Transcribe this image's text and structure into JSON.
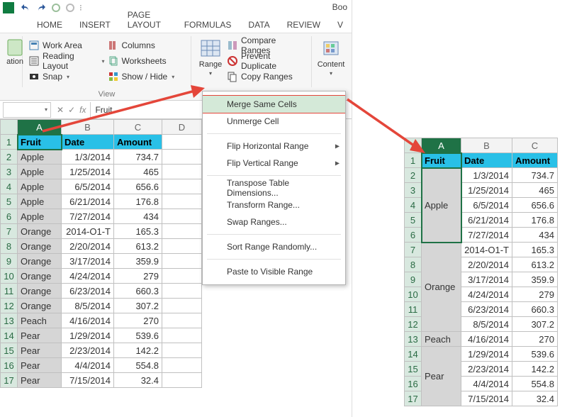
{
  "window": {
    "docName": "Boo"
  },
  "qat": {},
  "tabs": {
    "home": "HOME",
    "insert": "INSERT",
    "page": "PAGE LAYOUT",
    "formulas": "FORMULAS",
    "data": "DATA",
    "review": "REVIEW",
    "v": "V"
  },
  "ribbon": {
    "navigation": {
      "label": "ation"
    },
    "view": {
      "workArea": "Work Area",
      "readingLayout": "Reading Layout",
      "snap": "Snap",
      "columns": "Columns",
      "worksheets": "Worksheets",
      "showHide": "Show / Hide",
      "groupLabel": "View"
    },
    "range": {
      "label": "Range",
      "compare": "Compare Ranges",
      "prevent": "Prevent Duplicate",
      "copy": "Copy Ranges"
    },
    "content": {
      "label": "Content"
    }
  },
  "nameBox": "",
  "formula": "Fruit",
  "menu": {
    "merge": "Merge Same Cells",
    "unmerge": "Unmerge Cell",
    "flipH": "Flip Horizontal Range",
    "flipV": "Flip Vertical Range",
    "transpose": "Transpose Table Dimensions...",
    "transform": "Transform Range...",
    "swap": "Swap Ranges...",
    "sortR": "Sort Range Randomly...",
    "pasteVis": "Paste to Visible Range"
  },
  "table": {
    "headers": {
      "a": "Fruit",
      "b": "Date",
      "c": "Amount"
    },
    "rows": [
      {
        "a": "Apple",
        "b": "1/3/2014",
        "c": "734.7"
      },
      {
        "a": "Apple",
        "b": "1/25/2014",
        "c": "465"
      },
      {
        "a": "Apple",
        "b": "6/5/2014",
        "c": "656.6"
      },
      {
        "a": "Apple",
        "b": "6/21/2014",
        "c": "176.8"
      },
      {
        "a": "Apple",
        "b": "7/27/2014",
        "c": "434"
      },
      {
        "a": "Orange",
        "b": "2014-O1-T",
        "c": "165.3"
      },
      {
        "a": "Orange",
        "b": "2/20/2014",
        "c": "613.2"
      },
      {
        "a": "Orange",
        "b": "3/17/2014",
        "c": "359.9"
      },
      {
        "a": "Orange",
        "b": "4/24/2014",
        "c": "279"
      },
      {
        "a": "Orange",
        "b": "6/23/2014",
        "c": "660.3"
      },
      {
        "a": "Orange",
        "b": "8/5/2014",
        "c": "307.2"
      },
      {
        "a": "Peach",
        "b": "4/16/2014",
        "c": "270"
      },
      {
        "a": "Pear",
        "b": "1/29/2014",
        "c": "539.6"
      },
      {
        "a": "Pear",
        "b": "2/23/2014",
        "c": "142.2"
      },
      {
        "a": "Pear",
        "b": "4/4/2014",
        "c": "554.8"
      },
      {
        "a": "Pear",
        "b": "7/15/2014",
        "c": "32.4"
      }
    ]
  },
  "result": {
    "headers": {
      "a": "Fruit",
      "b": "Date",
      "c": "Amount"
    },
    "groups": [
      {
        "name": "Apple",
        "span": 5
      },
      {
        "name": "Orange",
        "span": 6
      },
      {
        "name": "Peach",
        "span": 1
      },
      {
        "name": "Pear",
        "span": 4
      }
    ]
  }
}
